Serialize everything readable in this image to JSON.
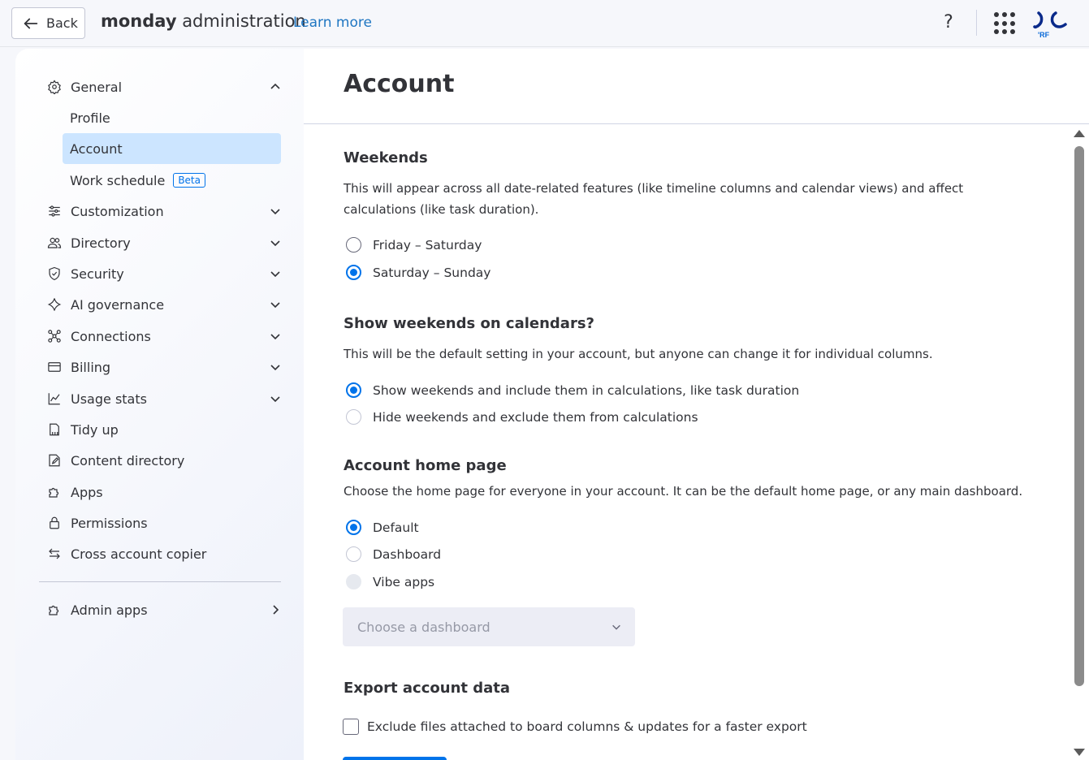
{
  "topbar": {
    "back_label": "Back",
    "brand_bold": "monday",
    "brand_rest": " administration",
    "learn_more": "Learn more",
    "help": "?",
    "logo_text": "'RF"
  },
  "sidebar": {
    "general": "General",
    "profile": "Profile",
    "account": "Account",
    "work_schedule": "Work schedule",
    "beta": "Beta",
    "items": [
      {
        "label": "Customization"
      },
      {
        "label": "Directory"
      },
      {
        "label": "Security"
      },
      {
        "label": "AI governance"
      },
      {
        "label": "Connections"
      },
      {
        "label": "Billing"
      },
      {
        "label": "Usage stats"
      },
      {
        "label": "Tidy up"
      },
      {
        "label": "Content directory"
      },
      {
        "label": "Apps"
      },
      {
        "label": "Permissions"
      },
      {
        "label": "Cross account copier"
      }
    ],
    "admin_apps": "Admin apps"
  },
  "main": {
    "title": "Account",
    "weekends": {
      "title": "Weekends",
      "desc": "This will appear across all date-related features (like timeline columns and calendar views) and affect calculations (like task duration).",
      "options": [
        "Friday – Saturday",
        "Saturday – Sunday"
      ],
      "selected": "Saturday – Sunday"
    },
    "show_weekends": {
      "title": "Show weekends on calendars?",
      "desc": "This will be the default setting in your account, but anyone can change it for individual columns.",
      "options": [
        "Show weekends and include them in calculations, like task duration",
        "Hide weekends and exclude them from calculations"
      ],
      "selected": "Show weekends and include them in calculations, like task duration"
    },
    "home_page": {
      "title": "Account home page",
      "desc": "Choose the home page for everyone in your account. It can be the default home page, or any main dashboard.",
      "options": [
        "Default",
        "Dashboard",
        "Vibe apps"
      ],
      "selected": "Default",
      "dropdown_placeholder": "Choose a dashboard"
    },
    "export": {
      "title": "Export account data",
      "checkbox_label": "Exclude files attached to board columns & updates for a faster export"
    }
  }
}
